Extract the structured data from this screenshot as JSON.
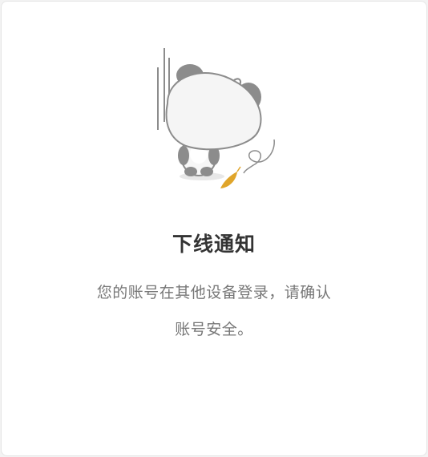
{
  "dialog": {
    "title": "下线通知",
    "message_line1": "您的账号在其他设备登录，请确认",
    "message_line2": "账号安全。"
  },
  "illustration": {
    "icon": "falling-panda-icon",
    "colors": {
      "panda_body": "#f5f5f5",
      "panda_dark": "#8c8c8c",
      "leaf": "#e0a52a"
    }
  }
}
